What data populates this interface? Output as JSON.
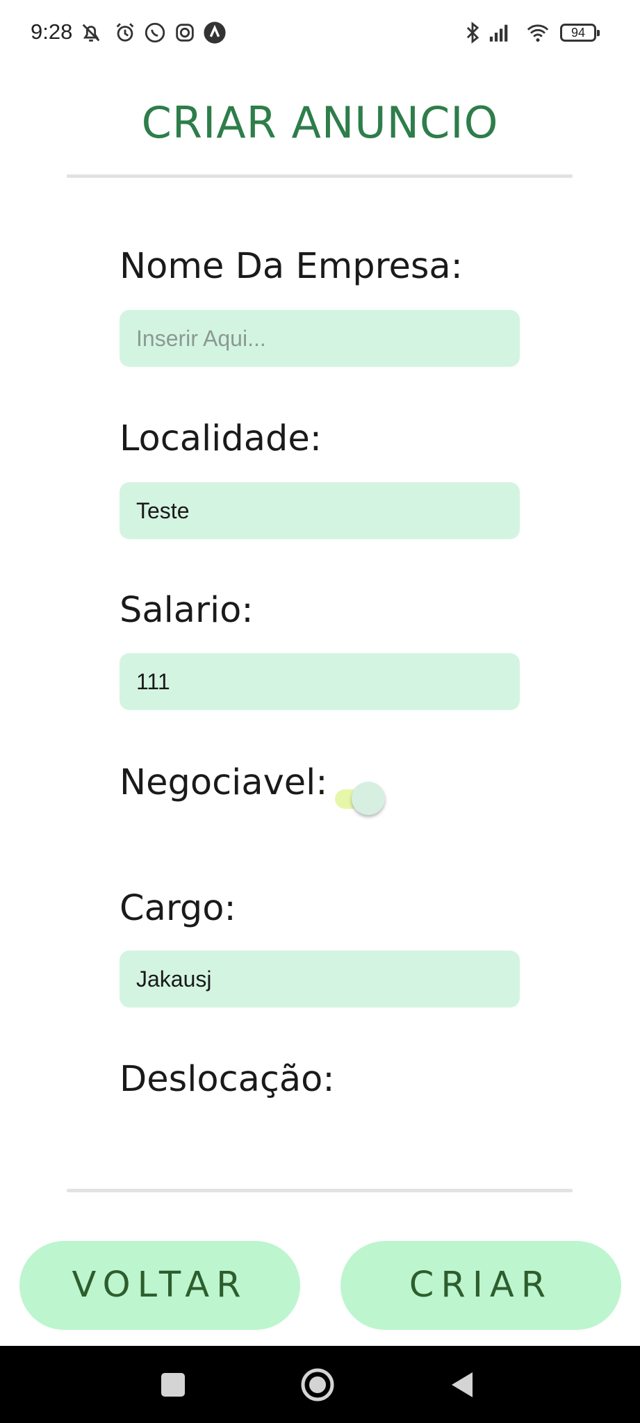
{
  "status_bar": {
    "time": "9:28",
    "battery": "94"
  },
  "header": {
    "title": "CRIAR ANUNCIO"
  },
  "form": {
    "company_label": "Nome Da Empresa:",
    "company_placeholder": "Inserir Aqui...",
    "company_value": "",
    "location_label": "Localidade:",
    "location_value": "Teste",
    "salary_label": "Salario:",
    "salary_value": "111",
    "negotiable_label": "Negociavel:",
    "negotiable_on": true,
    "role_label": "Cargo:",
    "role_value": "Jakausj",
    "relocation_label": "Deslocação:"
  },
  "actions": {
    "back_label": "VOLTAR",
    "create_label": "CRIAR"
  },
  "colors": {
    "title": "#2e7d4a",
    "input_bg": "#d4f4e2",
    "button_bg": "#bdf5cf",
    "toggle_track": "#e7f7a9"
  },
  "icons": {
    "status_left": [
      "muted-bell-icon",
      "alarm-icon",
      "whatsapp-icon",
      "instagram-icon",
      "app-a-icon"
    ],
    "status_right": [
      "bluetooth-icon",
      "signal-icon",
      "wifi-icon",
      "battery-icon"
    ],
    "nav": [
      "recents-square-icon",
      "home-circle-icon",
      "back-triangle-icon"
    ]
  }
}
